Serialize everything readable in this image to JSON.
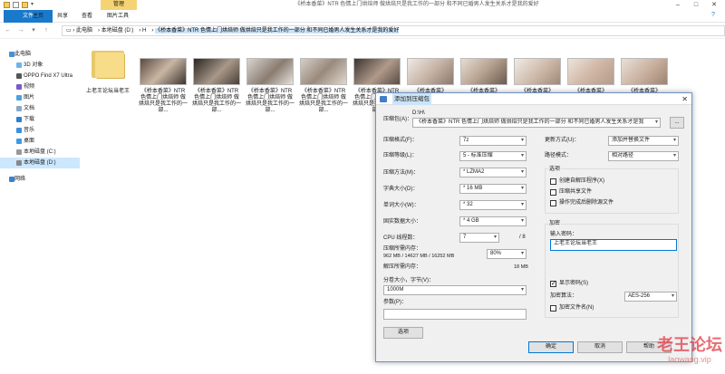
{
  "window": {
    "manage_tab": "管理",
    "title": "《桥本香菜》NTR 色情上门烘焙师 做烘焙只是我工作的一部分 和不同已婚男人发生关系才是我的爱好"
  },
  "ribbon": {
    "tabs": [
      "文件",
      "主页",
      "共享",
      "查看",
      "图片工具"
    ]
  },
  "address": {
    "segments": [
      "此电脑",
      "本地磁盘 (D:)",
      "H"
    ],
    "current": "《桥本香菜》NTR 色情上门烘焙师 做烘焙只是我工作的一部分 和不同已婚男人发生关系才是我的爱好"
  },
  "sidebar": {
    "items": [
      {
        "label": "此电脑",
        "icon": "computer-icon"
      },
      {
        "label": "3D 对象",
        "icon": "cube-icon"
      },
      {
        "label": "OPPO Find X7 Ultra",
        "icon": "phone-icon"
      },
      {
        "label": "视频",
        "icon": "video-icon"
      },
      {
        "label": "图片",
        "icon": "picture-icon"
      },
      {
        "label": "文档",
        "icon": "document-icon"
      },
      {
        "label": "下载",
        "icon": "download-icon"
      },
      {
        "label": "音乐",
        "icon": "music-icon"
      },
      {
        "label": "桌面",
        "icon": "desktop-icon"
      },
      {
        "label": "本地磁盘 (C:)",
        "icon": "drive-icon"
      },
      {
        "label": "本地磁盘 (D:)",
        "icon": "drive-icon"
      },
      {
        "label": "网络",
        "icon": "network-icon"
      }
    ]
  },
  "files": [
    {
      "name": "上老王论坛当老王",
      "type": "folder"
    },
    {
      "name": "《桥本香菜》NTR 色情上门烘焙师 做烘焙只是我工作的一部...",
      "type": "video"
    },
    {
      "name": "《桥本香菜》NTR 色情上门烘焙师 做烘焙只是我工作的一部...",
      "type": "video"
    },
    {
      "name": "《桥本香菜》NTR 色情上门烘焙师 做烘焙只是我工作的一部...",
      "type": "video"
    },
    {
      "name": "《桥本香菜》NTR 色情上门烘焙师 做烘焙只是我工作的一部...",
      "type": "video"
    },
    {
      "name": "《桥本香菜》NTR 色情上门烘焙师 做烘焙只是我工作的一部...",
      "type": "image"
    },
    {
      "name": "《桥本香菜》",
      "type": "image"
    },
    {
      "name": "《桥本香菜》",
      "type": "image"
    },
    {
      "name": "《桥本香菜》",
      "type": "image"
    },
    {
      "name": "《桥本香菜》",
      "type": "image"
    },
    {
      "name": "《桥本香菜》",
      "type": "image"
    }
  ],
  "dialog": {
    "title": "添加到压缩包",
    "archive_label": "压缩包(A)：",
    "archive_dir": "D:\\H\\",
    "archive_value": "《桥本香菜》NTR 色情上门烘焙师 做烘焙只是我工作的一部分 和不同已婚男人发生关系才是我",
    "browse": "...",
    "format_label": "压缩格式(F)：",
    "format_value": "7z",
    "level_label": "压缩等级(L)：",
    "level_value": "5 - 标准压缩",
    "method_label": "压缩方法(M)：",
    "method_value": "* LZMA2",
    "dict_label": "字典大小(D)：",
    "dict_value": "* 16 MB",
    "word_label": "单词大小(W)：",
    "word_value": "* 32",
    "solid_label": "固实数据大小：",
    "solid_value": "* 4 GB",
    "threads_label": "CPU 线程数：",
    "threads_value": "7",
    "threads_max": "/ 8",
    "mem_label": "压缩所需内存：",
    "mem_value": "962 MB / 14627 MB / 16252 MB",
    "mem_pct": "80%",
    "decomp_label": "解压所需内存：",
    "decomp_value": "18 MB",
    "split_label": "分卷大小，字节(V)：",
    "split_value": "1000M",
    "params_label": "参数(P)：",
    "params_value": "",
    "options_btn": "选项",
    "update_label": "更新方式(U)：",
    "update_value": "添加并替换文件",
    "path_label": "路径模式：",
    "path_value": "相对路径",
    "opt_group": "选项",
    "opt1": "创建自解压程序(X)",
    "opt2": "压缩共享文件",
    "opt3": "操作完成后删除源文件",
    "enc_group": "加密",
    "pwd_label": "输入密码：",
    "pwd_value": "上老王论坛当老王",
    "show_pwd": "显示密码(S)",
    "enc_method_label": "加密算法：",
    "enc_method_value": "AES-256",
    "enc_names": "加密文件名(N)",
    "ok": "确定",
    "cancel": "取消",
    "help": "帮助"
  },
  "watermark": {
    "line1": "老王论坛",
    "line2": "laowang.vip"
  }
}
